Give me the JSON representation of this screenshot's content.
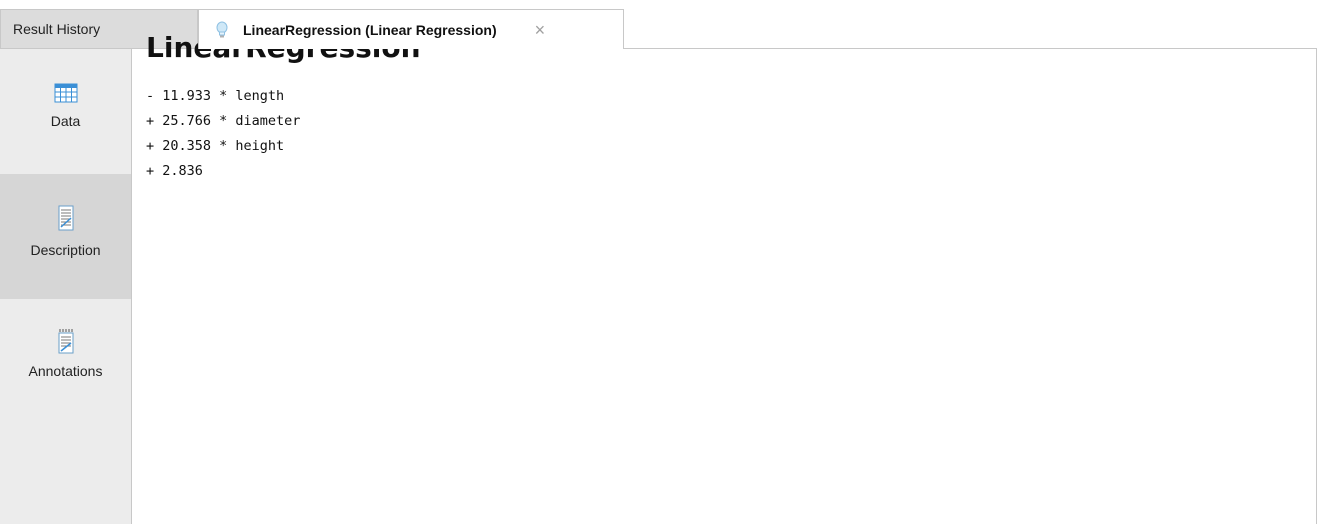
{
  "tabs": {
    "history_label": "Result History",
    "model_label": "LinearRegression (Linear Regression)",
    "close_glyph": "×"
  },
  "sidebar": {
    "items": [
      {
        "label": "Data",
        "icon": "table-icon",
        "selected": false
      },
      {
        "label": "Description",
        "icon": "document-icon",
        "selected": true
      },
      {
        "label": "Annotations",
        "icon": "notepad-icon",
        "selected": false
      }
    ]
  },
  "main": {
    "title": "LinearRegression",
    "formula": [
      "- 11.933 * length",
      "+ 25.766 * diameter",
      "+ 20.358 * height",
      "+ 2.836"
    ]
  },
  "colors": {
    "accent_icon": "#3a8fd6",
    "selected_bg": "#d6d6d6",
    "sidebar_bg": "#ececec"
  }
}
